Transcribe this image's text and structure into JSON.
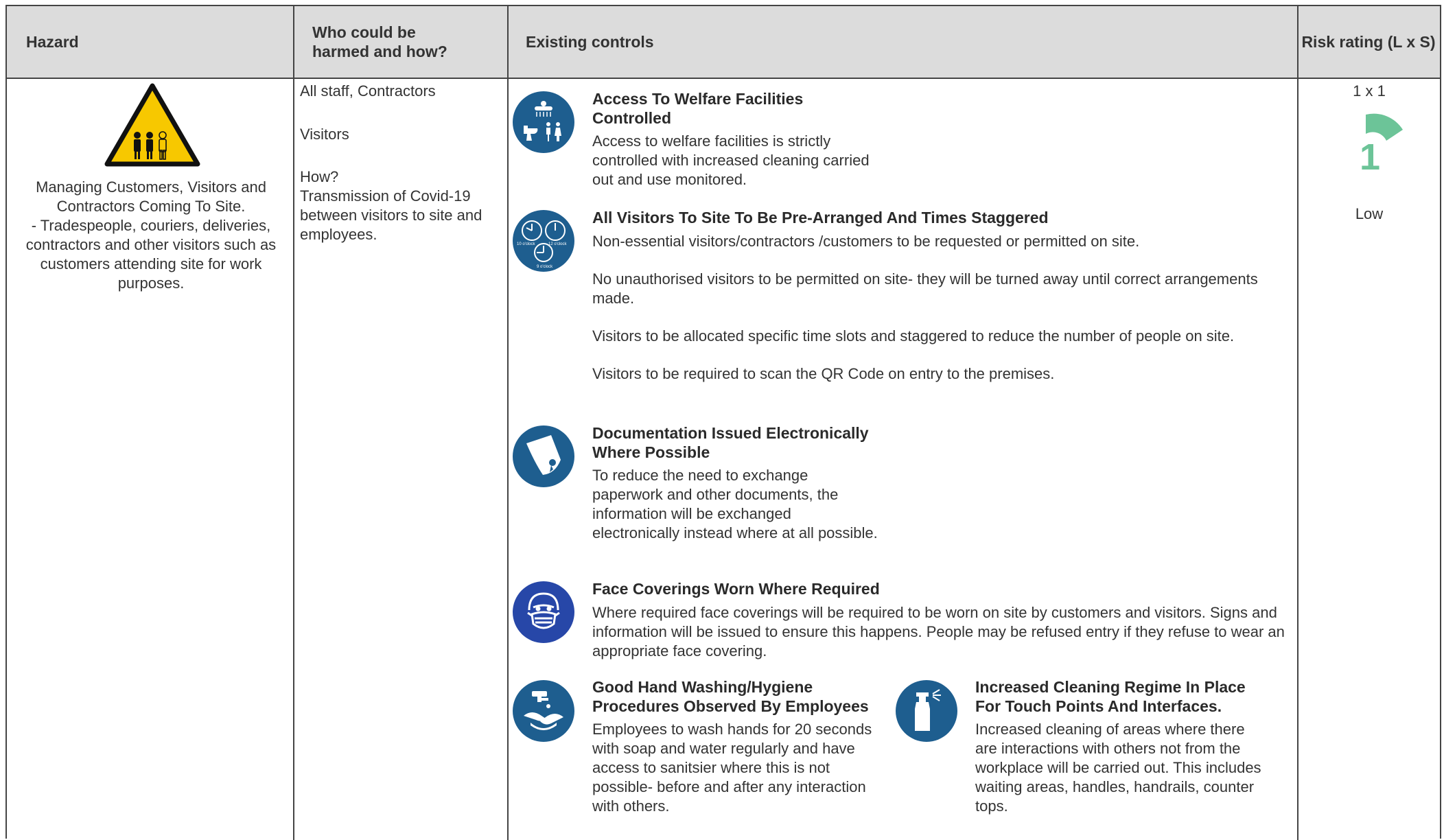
{
  "header": {
    "hazard": "Hazard",
    "who": "Who could be harmed and how?",
    "controls": "Existing controls",
    "risk": "Risk rating (L x S)"
  },
  "hazard": {
    "icon": "warning-people-icon",
    "description": "Managing Customers, Visitors and Contractors Coming To Site.\n- Tradespeople, couriers, deliveries, contractors and other visitors such as customers attending site for work purposes."
  },
  "who": {
    "line1": "All staff, Contractors",
    "line2": "Visitors",
    "how_label": "How?",
    "how_text": "Transmission of Covid-19 between visitors to site and employees."
  },
  "controls": [
    {
      "icon": "welfare-facilities-icon",
      "title": "Access To Welfare Facilities Controlled",
      "paragraphs": [
        "Access to welfare facilities is strictly controlled with increased cleaning carried out and use monitored."
      ]
    },
    {
      "icon": "clocks-icon",
      "title": "All Visitors To Site To Be Pre-Arranged And Times Staggered",
      "paragraphs": [
        "Non-essential visitors/contractors /customers to be requested or permitted on site.",
        "No unauthorised visitors to be permitted on site- they will be turned away until correct arrangements made.",
        "Visitors to be allocated specific time slots and staggered to reduce the number of people on site.",
        "Visitors to be required to scan the QR Code on entry to the premises."
      ]
    },
    {
      "icon": "document-icon",
      "title": "Documentation Issued Electronically Where Possible",
      "paragraphs": [
        "To reduce the need to exchange paperwork and other documents, the information will be exchanged electronically instead where at all possible."
      ]
    },
    {
      "icon": "face-mask-icon",
      "title": "Face Coverings Worn Where Required",
      "paragraphs": [
        "Where required face coverings will be required to be worn on site by customers and visitors. Signs and information will be issued to ensure this happens. People may be refused entry if they refuse to wear an appropriate face covering."
      ]
    },
    {
      "icon": "hand-washing-icon",
      "title": "Good Hand Washing/Hygiene Procedures Observed By Employees",
      "paragraphs": [
        "Employees to wash hands for 20 seconds with soap and water regularly and have access to sanitsier where this is not possible- before and after any interaction with others."
      ]
    },
    {
      "icon": "spray-bottle-icon",
      "title": "Increased Cleaning Regime In Place For Touch Points And Interfaces.",
      "paragraphs": [
        "Increased cleaning of areas where there are interactions with others not from the workplace will be carried out. This includes waiting areas, handles, handrails, counter tops."
      ]
    }
  ],
  "clock_labels": [
    "10 o'clock",
    "12 o'clock",
    "9 o'clock"
  ],
  "risk": {
    "rating": "1 x 1",
    "score": "1",
    "level": "Low",
    "gauge_color": "#6cc498"
  }
}
